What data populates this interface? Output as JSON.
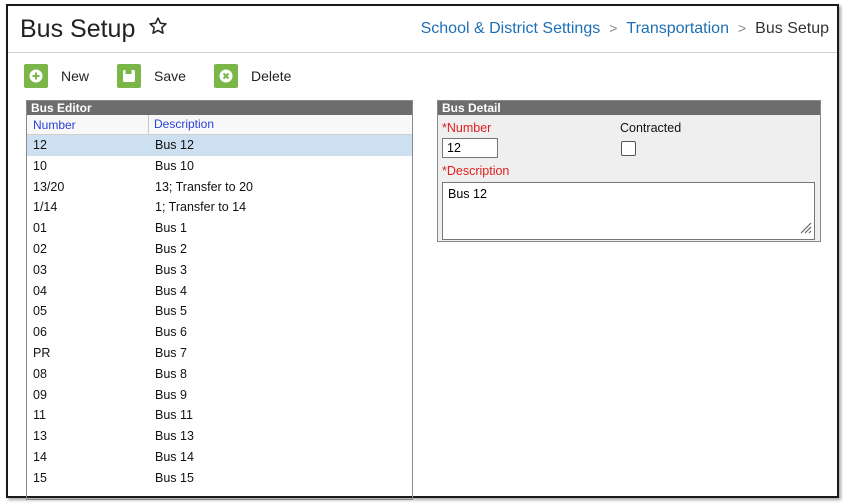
{
  "header": {
    "title": "Bus Setup",
    "breadcrumb": [
      "School & District Settings",
      "Transportation",
      "Bus Setup"
    ]
  },
  "toolbar": {
    "new_label": "New",
    "save_label": "Save",
    "delete_label": "Delete"
  },
  "editor": {
    "title": "Bus Editor",
    "columns": [
      "Number",
      "Description"
    ],
    "selected_index": 0,
    "rows": [
      {
        "number": "12",
        "description": "Bus 12"
      },
      {
        "number": "10",
        "description": "Bus 10"
      },
      {
        "number": "13/20",
        "description": "13; Transfer to 20"
      },
      {
        "number": "1/14",
        "description": "1; Transfer to 14"
      },
      {
        "number": "01",
        "description": "Bus 1"
      },
      {
        "number": "02",
        "description": "Bus 2"
      },
      {
        "number": "03",
        "description": "Bus 3"
      },
      {
        "number": "04",
        "description": "Bus 4"
      },
      {
        "number": "05",
        "description": "Bus 5"
      },
      {
        "number": "06",
        "description": "Bus 6"
      },
      {
        "number": "PR",
        "description": "Bus 7"
      },
      {
        "number": "08",
        "description": "Bus 8"
      },
      {
        "number": "09",
        "description": "Bus 9"
      },
      {
        "number": "11",
        "description": "Bus 11"
      },
      {
        "number": "13",
        "description": "Bus 13"
      },
      {
        "number": "14",
        "description": "Bus 14"
      },
      {
        "number": "15",
        "description": "Bus 15"
      }
    ]
  },
  "detail": {
    "title": "Bus Detail",
    "number_label": "*Number",
    "number_value": "12",
    "contracted_label": "Contracted",
    "contracted_checked": false,
    "description_label": "*Description",
    "description_value": "Bus 12"
  },
  "colors": {
    "accent_green": "#7ab648",
    "link_blue": "#1f6fb5",
    "required_red": "#e02020",
    "selection_blue": "#cde0f2",
    "panel_header_gray": "#6d6d6d"
  }
}
